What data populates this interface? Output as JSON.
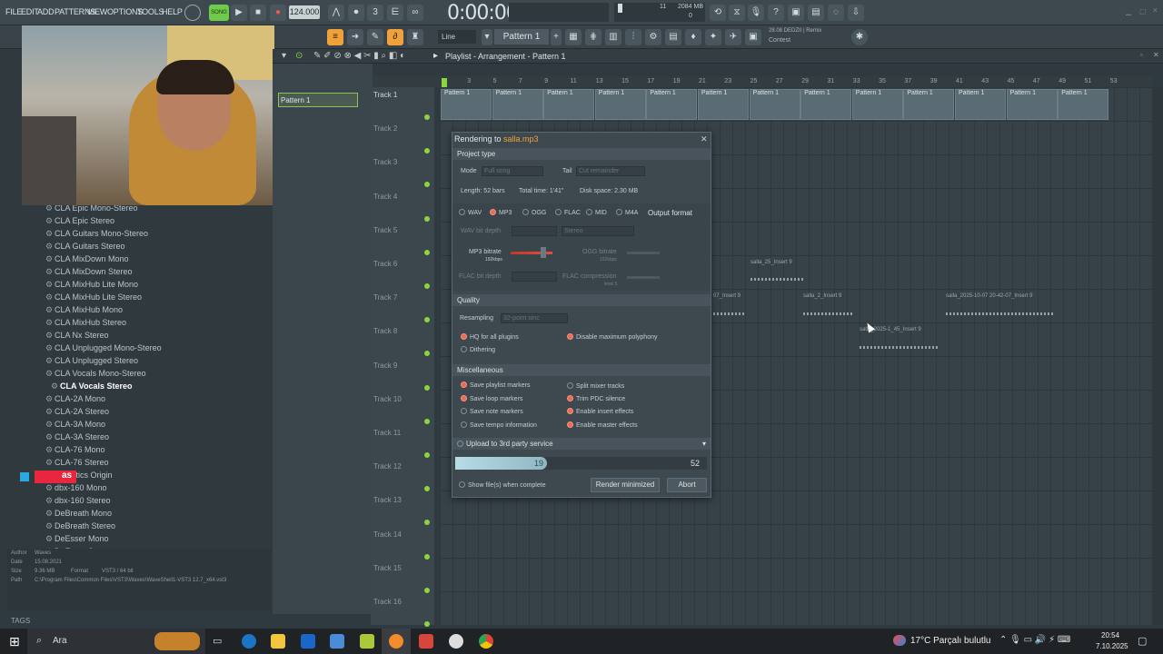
{
  "menu": [
    "FILE",
    "EDIT",
    "ADD",
    "PATTERNS",
    "VIEW",
    "OPTIONS",
    "TOOLS",
    "HELP"
  ],
  "tempo": "124.000",
  "time": "0:00:00",
  "cpu": {
    "mem": "2084 MB",
    "voices": "11",
    "val": "0"
  },
  "news": {
    "line1": "28.08  DEDZII | Remix",
    "line2": "Contest"
  },
  "toolbar": {
    "snap": "Line",
    "pattern": "Pattern 1"
  },
  "playlist": {
    "title": "Playlist - Arrangement - Pattern 1",
    "picker_item": "Pattern 1"
  },
  "ruler": [
    "1",
    "3",
    "5",
    "7",
    "9",
    "11",
    "13",
    "15",
    "17",
    "19",
    "21",
    "23",
    "25",
    "27",
    "29",
    "31",
    "33",
    "35",
    "37",
    "39",
    "41",
    "43",
    "45",
    "47",
    "49",
    "51",
    "53"
  ],
  "tracks": [
    "Track 1",
    "Track 2",
    "Track 3",
    "Track 4",
    "Track 5",
    "Track 6",
    "Track 7",
    "Track 8",
    "Track 9",
    "Track 10",
    "Track 11",
    "Track 12",
    "Track 13",
    "Track 14",
    "Track 15",
    "Track 16"
  ],
  "pattern_block": "Pattern 1",
  "clips": [
    "salla_25_Insert 9",
    "salla_2_Insert 9",
    "07_Insert 9",
    "salla_2025-10-07 20-42-07_Insert 9",
    "salla_2025-1_45_Insert 9"
  ],
  "browser": {
    "items": [
      "CLA Epic Mono-Stereo",
      "CLA Epic Stereo",
      "CLA Guitars Mono-Stereo",
      "CLA Guitars Stereo",
      "CLA MixDown Mono",
      "CLA MixDown Stereo",
      "CLA MixHub Lite Mono",
      "CLA MixHub Lite Stereo",
      "CLA MixHub Mono",
      "CLA MixHub Stereo",
      "CLA Nx Stereo",
      "CLA Unplugged Mono-Stereo",
      "CLA Unplugged Stereo",
      "CLA Vocals Mono-Stereo",
      "CLA Vocals Stereo",
      "CLA-2A Mono",
      "CLA-2A Stereo",
      "CLA-3A Mono",
      "CLA-3A Stereo",
      "CLA-76 Mono",
      "CLA-76 Stereo",
      "Cymatics Origin",
      "dbx-160 Mono",
      "dbx-160 Stereo",
      "DeBreath Mono",
      "DeBreath Stereo",
      "DeEsser Mono",
      "DeEsser Stereo"
    ],
    "selected": "CLA Vocals Stereo",
    "info": {
      "author_label": "Author",
      "author": "Waves",
      "date_label": "Date",
      "date": "15.08.2021",
      "size_label": "Size",
      "size": "9.36 MB",
      "format_label": "Format",
      "format": "VST3 / 64 bit",
      "path_label": "Path",
      "path": "C:\\Program Files\\Common Files\\VST3\\Waves\\WaveShell1-VST3 12.7_x64.vst3"
    },
    "tags": "TAGS"
  },
  "dialog": {
    "title_prefix": "Rendering to ",
    "filename": "salla.mp3",
    "sec_project": "Project type",
    "mode_label": "Mode",
    "mode_value": "Full song",
    "tail_label": "Tail",
    "tail_value": "Cut remainder",
    "length": "Length: 52 bars",
    "total_time": "Total time: 1'41\"",
    "disk": "Disk space: 2.30 MB",
    "formats": [
      "WAV",
      "MP3",
      "OGG",
      "FLAC",
      "MID",
      "M4A"
    ],
    "output_format": "Output format",
    "wav_depth": "WAV bit depth",
    "stereo": "Stereo",
    "mp3_bitrate": "MP3 bitrate",
    "mp3_kbps": "192kbps",
    "ogg_bitrate": "OGG bitrate",
    "ogg_kbps": "192kbps",
    "flac_depth": "FLAC bit depth",
    "flac_comp": "FLAC compression",
    "flac_level": "level 5",
    "sec_quality": "Quality",
    "resampling": "Resampling",
    "resampling_value": "32-point sinc",
    "hq": "HQ for all plugins",
    "disable_poly": "Disable maximum polyphony",
    "dithering": "Dithering",
    "sec_misc": "Miscellaneous",
    "misc_left": [
      "Save playlist markers",
      "Save loop markers",
      "Save note markers",
      "Save tempo information"
    ],
    "misc_right": [
      "Split mixer tracks",
      "Trim PDC silence",
      "Enable insert effects",
      "Enable master effects"
    ],
    "upload": "Upload to 3rd party service",
    "progress_value": "19",
    "progress_max": "52",
    "progress_fraction": 0.365,
    "show_files": "Show file(s) when complete",
    "render_min": "Render minimized",
    "abort": "Abort"
  },
  "taskbar": {
    "search": "Ara",
    "weather": "17°C  Parçalı bulutlu",
    "time": "20:54",
    "date": "7.10.2025"
  },
  "overlay": "as"
}
